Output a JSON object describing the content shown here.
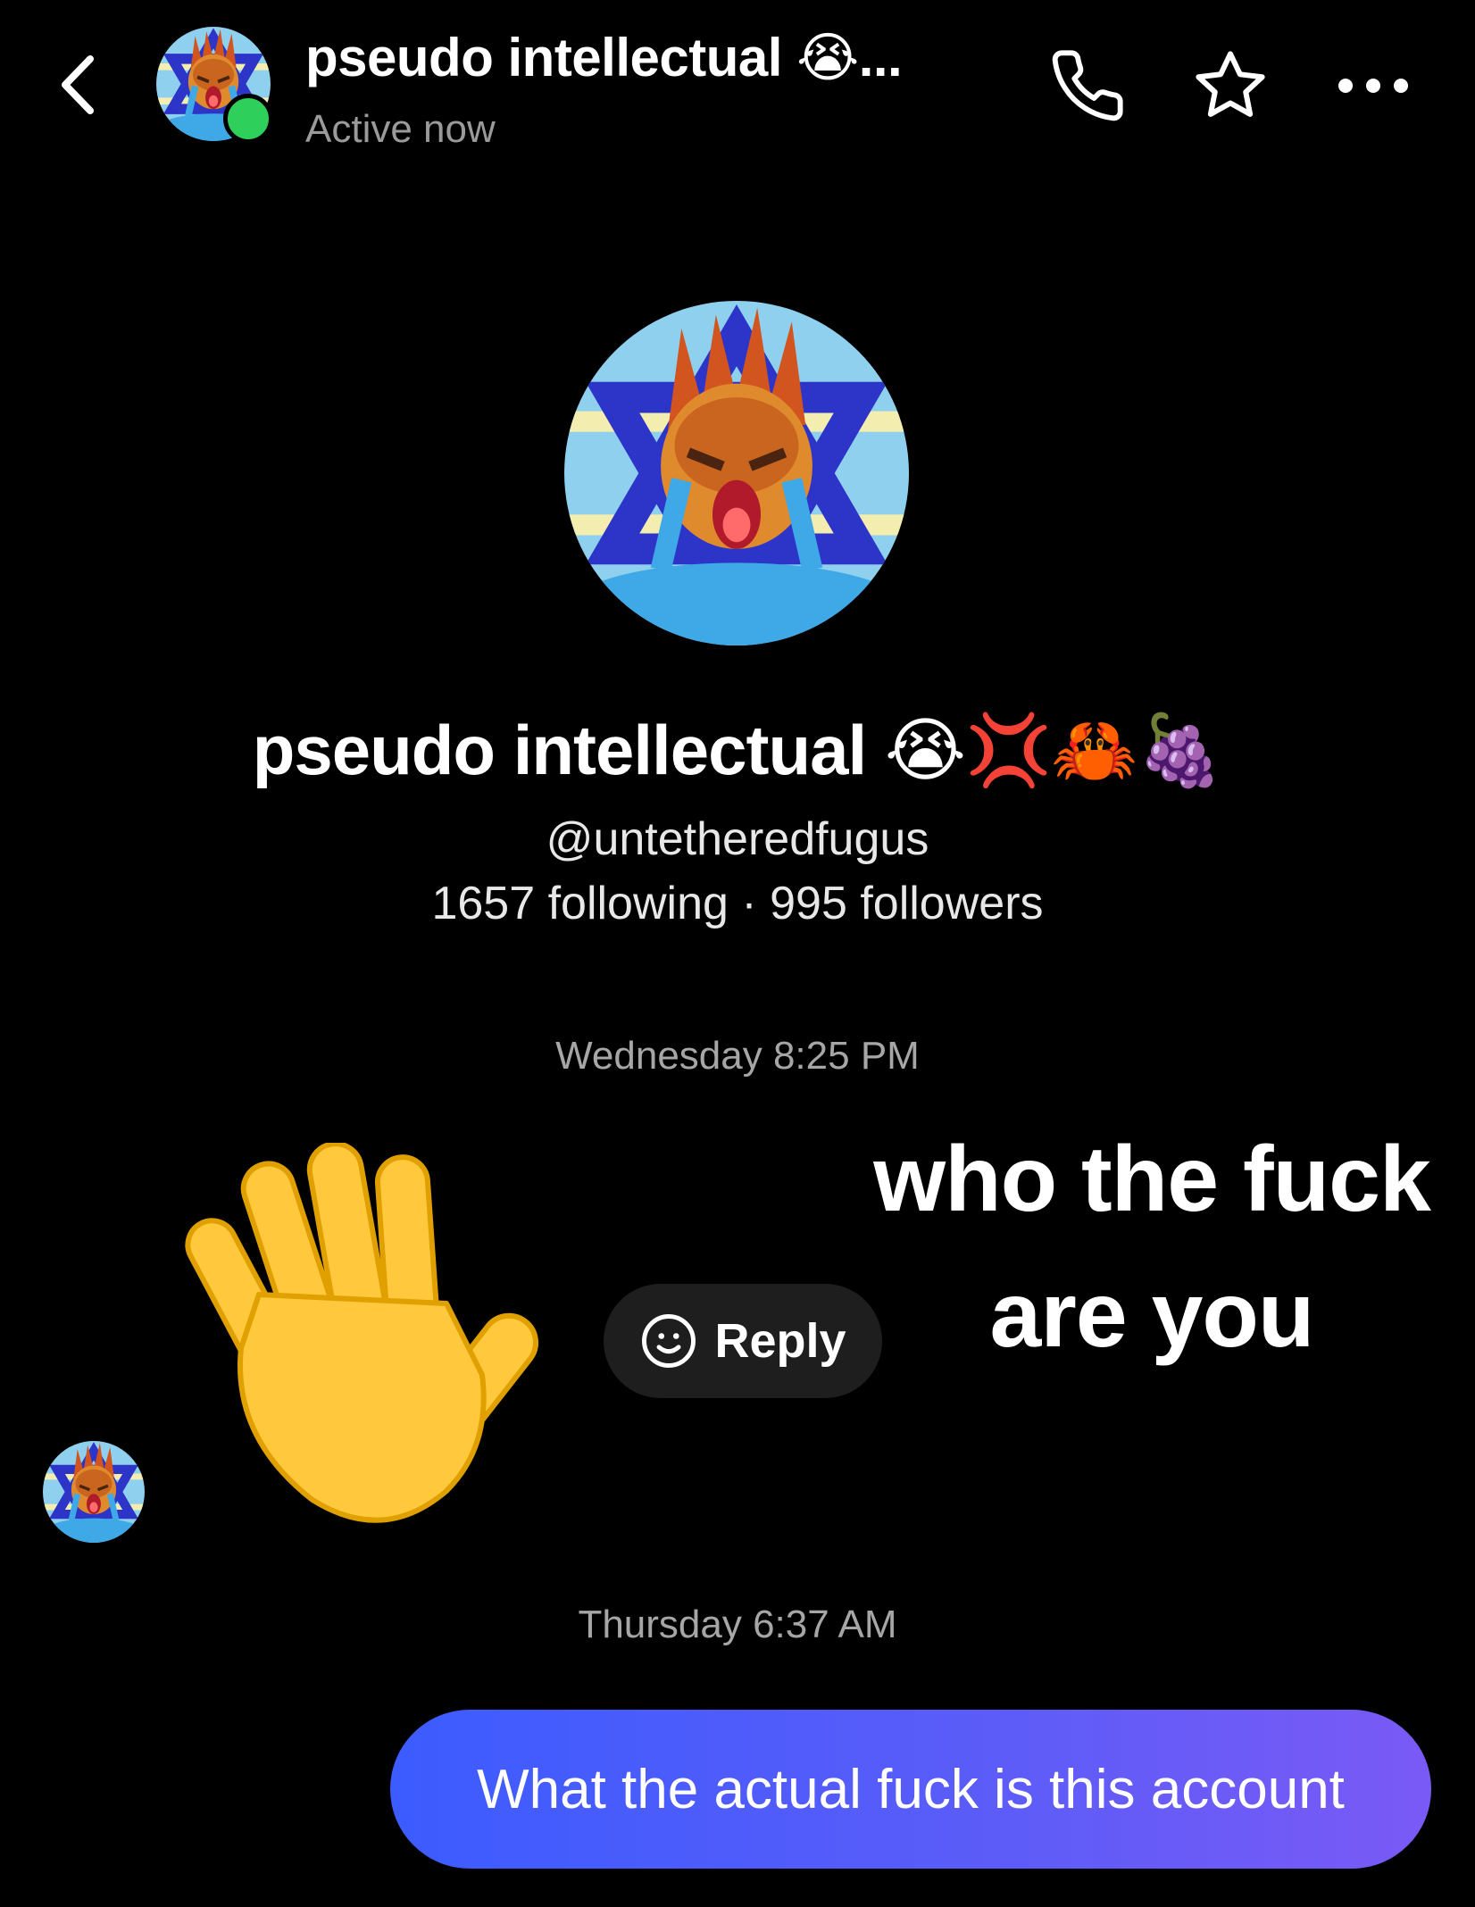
{
  "header": {
    "title": "pseudo intellectual 😭...",
    "status": "Active now",
    "back_icon": "chevron-left-icon",
    "phone_icon": "phone-icon",
    "star_icon": "star-icon",
    "more_icon": "more-horizontal-icon",
    "online_color": "#2fcf5b"
  },
  "profile": {
    "name": "pseudo intellectual 😭💢🦀🍇",
    "handle": "@untetheredfugus",
    "stats": "1657 following · 995 followers"
  },
  "conversation": {
    "timestamp_1": "Wednesday 8:25 PM",
    "received_emoji": "👋",
    "reply_label": "Reply",
    "reply_icon": "smiley-icon",
    "timestamp_2": "Thursday 6:37 AM",
    "sent_message": "What the actual fuck is this account",
    "sent_bubble_colors": [
      "#3c5cff",
      "#7a5af6"
    ]
  },
  "overlay": {
    "caption": "who the fuck are you"
  }
}
